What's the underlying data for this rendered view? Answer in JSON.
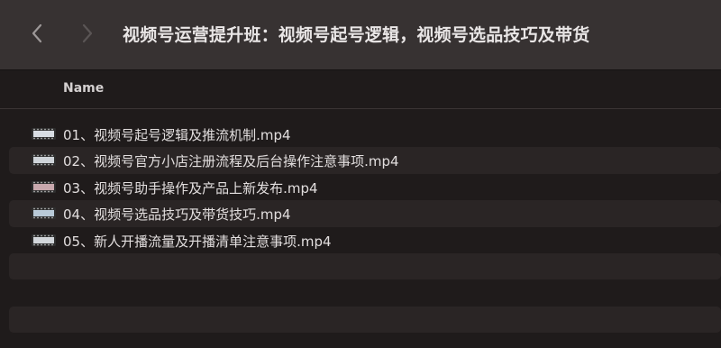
{
  "window": {
    "title": "视频号运营提升班：视频号起号逻辑，视频号选品技巧及带货"
  },
  "nav": {
    "back_icon": "chevron-left-icon",
    "forward_icon": "chevron-right-icon"
  },
  "columns": {
    "name_header": "Name"
  },
  "files": [
    {
      "label": "01、视频号起号逻辑及推流机制.mp4",
      "icon": "video-thumbnail-icon",
      "thumb_color": "#d8dde3"
    },
    {
      "label": "02、视频号官方小店注册流程及后台操作注意事项.mp4",
      "icon": "video-thumbnail-icon",
      "thumb_color": "#cfd4d9"
    },
    {
      "label": "03、视频号助手操作及产品上新发布.mp4",
      "icon": "video-thumbnail-icon",
      "thumb_color": "#c8a8ad"
    },
    {
      "label": "04、视频号选品技巧及带货技巧.mp4",
      "icon": "video-thumbnail-icon",
      "thumb_color": "#b9cad8"
    },
    {
      "label": "05、新人开播流量及开播清单注意事项.mp4",
      "icon": "video-thumbnail-icon",
      "thumb_color": "#d2d6da"
    }
  ],
  "colors": {
    "background": "#1f1b1b",
    "titlebar": "#373232",
    "stripe": "#2a2525",
    "text": "#e2dede"
  }
}
